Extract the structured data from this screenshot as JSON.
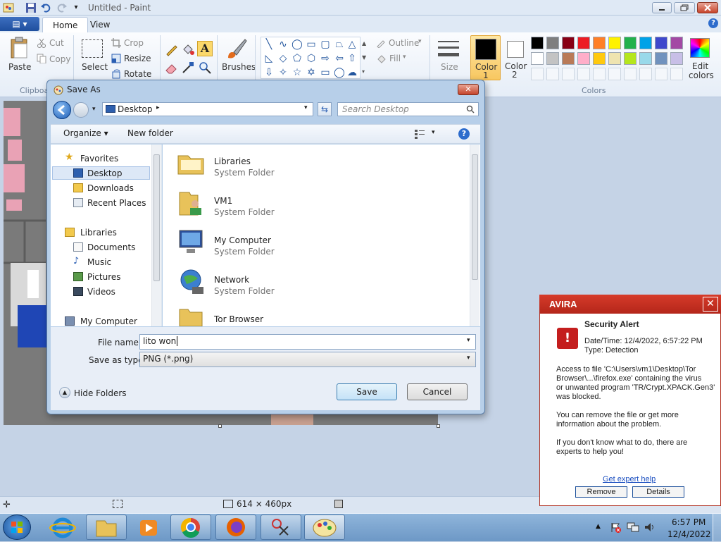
{
  "app": {
    "title": "Untitled - Paint"
  },
  "ribbon": {
    "menu_label": "▤ ▾",
    "tabs": [
      "Home",
      "View"
    ],
    "clipboard": {
      "paste": "Paste",
      "cut": "Cut",
      "copy": "Copy",
      "group": "Clipboa"
    },
    "image": {
      "select": "Select",
      "crop": "Crop",
      "resize": "Resize",
      "rotate": "Rotate"
    },
    "brushes": "Brushes",
    "shapes": {
      "outline": "Outline",
      "fill": "Fill"
    },
    "size": "Size",
    "color1": {
      "line1": "Color",
      "line2": "1"
    },
    "color2": {
      "line1": "Color",
      "line2": "2"
    },
    "colors_group": "Colors",
    "edit_colors": {
      "line1": "Edit",
      "line2": "colors"
    },
    "palette": [
      "#000000",
      "#7f7f7f",
      "#880015",
      "#ed1c24",
      "#ff7f27",
      "#fff200",
      "#22b14c",
      "#00a2e8",
      "#3f48cc",
      "#a349a4",
      "#ffffff",
      "#c3c3c3",
      "#b97a57",
      "#ffaec9",
      "#ffc90e",
      "#efe4b0",
      "#b5e61d",
      "#99d9ea",
      "#7092be",
      "#c8bfe7"
    ]
  },
  "status": {
    "size": "614 × 460px"
  },
  "dialog": {
    "title": "Save As",
    "address": "Desktop",
    "search_placeholder": "Search Desktop",
    "organize": "Organize ▾",
    "new_folder": "New folder",
    "nav": {
      "favorites": "Favorites",
      "desktop": "Desktop",
      "downloads": "Downloads",
      "recent": "Recent Places",
      "libraries": "Libraries",
      "documents": "Documents",
      "music": "Music",
      "pictures": "Pictures",
      "videos": "Videos",
      "computer": "My Computer"
    },
    "files": [
      {
        "name": "Libraries",
        "type": "System Folder"
      },
      {
        "name": "VM1",
        "type": "System Folder"
      },
      {
        "name": "My Computer",
        "type": "System Folder"
      },
      {
        "name": "Network",
        "type": "System Folder"
      },
      {
        "name": "Tor Browser",
        "type": ""
      }
    ],
    "file_name_label": "File name:",
    "file_name_value": "lito won",
    "save_type_label": "Save as type:",
    "save_type_value": "PNG (*.png)",
    "hide_folders": "Hide Folders",
    "save": "Save",
    "cancel": "Cancel"
  },
  "avira": {
    "brand": "AVIRA",
    "heading": "Security Alert",
    "datetime": "Date/Time: 12/4/2022, 6:57:22 PM",
    "type": "Type: Detection",
    "body_lines": [
      "Access to file 'C:\\Users\\vm1\\Desktop\\Tor",
      "Browser\\...\\firefox.exe' containing the virus",
      "or unwanted program 'TR/Crypt.XPACK.Gen3'",
      "was blocked."
    ],
    "body2_lines": [
      "You can remove the file or get more",
      "information about the problem."
    ],
    "body3_lines": [
      "If you don't know what to do, there are",
      "experts to help you!"
    ],
    "link": "Get expert help",
    "remove": "Remove",
    "details": "Details"
  },
  "taskbar": {
    "time": "6:57 PM",
    "date": "12/4/2022"
  }
}
